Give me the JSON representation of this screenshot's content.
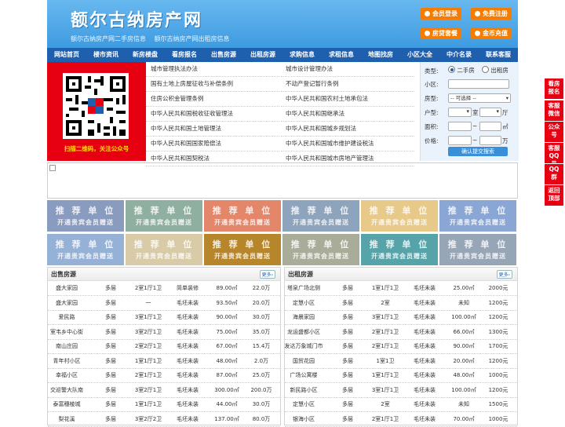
{
  "header": {
    "logo": "额尔古纳房产网",
    "sublinks": [
      "额尔古纳房产网二手房信息",
      "额尔古纳房产网出租房信息"
    ],
    "buttons": [
      "会员登录",
      "免费注册",
      "房贷套餐",
      "金币充值"
    ]
  },
  "nav": [
    "网站首页",
    "楼市资讯",
    "新房楼盘",
    "看房报名",
    "出售房源",
    "出租房源",
    "求购信息",
    "求租信息",
    "地图找房",
    "小区大全",
    "中介名录",
    "联系客服"
  ],
  "qr": {
    "caption": "扫描二维码，关注公众号"
  },
  "laws": {
    "left": [
      "城市管理执法办法",
      "国有土地上房屋征收与补偿条例",
      "住房公积金管理条例",
      "中华人民共和国税收征收管理法",
      "中华人民共和国土地管理法",
      "中华人民共和国国家赔偿法",
      "中华人民共和国契税法"
    ],
    "right": [
      "城市设计管理办法",
      "不动产登记暂行条例",
      "中华人民共和国农村土地承包法",
      "中华人民共和国继承法",
      "中华人民共和国城乡规划法",
      "中华人民共和国城市维护建设税法",
      "中华人民共和国城市房地产管理法"
    ]
  },
  "search": {
    "type_label": "类型:",
    "radio1": "二手房",
    "radio2": "出租房",
    "community_label": "小区:",
    "room_type_label": "房型:",
    "room_type_value": "-- 可选择 --",
    "layout_label": "户型:",
    "room_unit": "室",
    "hall_unit": "厅",
    "area_label": "面积:",
    "area_unit": "㎡",
    "price_label": "价格:",
    "price_unit": "万",
    "tilde": "~",
    "submit": "确认提交搜索"
  },
  "ads": {
    "line1": "推 荐 单 位",
    "line2": "开通贵宾会员赠送"
  },
  "ad_colors": [
    "#8a9bc0",
    "#8fb0a0",
    "#e4866a",
    "#8ea3bc",
    "#e7c98a",
    "#8aa6d4",
    "#96b1d6",
    "#d9cba8",
    "#b8862a",
    "#a8ac98",
    "#56a3aa",
    "#97a6b6"
  ],
  "sale": {
    "title": "出售房源",
    "more": "更多",
    "rows": [
      [
        "盛大家园",
        "多层",
        "2室1厅1卫",
        "简单装修",
        "89.00㎡",
        "22.0万"
      ],
      [
        "盛大家园",
        "多层",
        "一",
        "毛坯未装",
        "93.50㎡",
        "20.0万"
      ],
      [
        "爱民路",
        "多层",
        "3室1厅1卫",
        "毛坯未装",
        "90.00㎡",
        "30.0万"
      ],
      [
        "室韦乡中心街",
        "多层",
        "3室2厅1卫",
        "毛坯未装",
        "75.00㎡",
        "35.0万"
      ],
      [
        "南山庄园",
        "多层",
        "2室2厅1卫",
        "毛坯未装",
        "67.00㎡",
        "15.4万"
      ],
      [
        "青年村小区",
        "多层",
        "1室1厅1卫",
        "毛坯未装",
        "48.00㎡",
        "2.0万"
      ],
      [
        "幸福小区",
        "多层",
        "2室1厅1卫",
        "毛坯未装",
        "87.00㎡",
        "25.0万"
      ],
      [
        "交巡警大队南",
        "多层",
        "3室2厅1卫",
        "毛坯未装",
        "300.00㎡",
        "200.0万"
      ],
      [
        "泰富穗棱城",
        "多层",
        "1室1厅1卫",
        "毛坯未装",
        "44.00㎡",
        "30.0万"
      ],
      [
        "梨花溪",
        "多层",
        "3室2厅2卫",
        "毛坯未装",
        "137.00㎡",
        "80.0万"
      ]
    ]
  },
  "rent": {
    "title": "出租房源",
    "more": "更多",
    "rows": [
      [
        "塔泉广场北侧",
        "多层",
        "1室1厅1卫",
        "毛坯未装",
        "25.00㎡",
        "2000元"
      ],
      [
        "定慧小区",
        "多层",
        "2室",
        "毛坯未装",
        "未知",
        "1200元"
      ],
      [
        "海晨家园",
        "多层",
        "3室1厅1卫",
        "毛坯未装",
        "100.00㎡",
        "1200元"
      ],
      [
        "龙运盛都小区",
        "多层",
        "2室1厅1卫",
        "毛坯未装",
        "66.00㎡",
        "1300元"
      ],
      [
        "发达万象城门市",
        "多层",
        "2室1厅1卫",
        "毛坯未装",
        "90.00㎡",
        "1700元"
      ],
      [
        "国贸花园",
        "多层",
        "1室1卫",
        "毛坯未装",
        "20.00㎡",
        "1200元"
      ],
      [
        "广场公寓楼",
        "多层",
        "1室1厅1卫",
        "毛坯未装",
        "48.00㎡",
        "1000元"
      ],
      [
        "新民路小区",
        "多层",
        "3室1厅1卫",
        "毛坯未装",
        "100.00㎡",
        "1200元"
      ],
      [
        "定慧小区",
        "多层",
        "2室",
        "毛坯未装",
        "未知",
        "1500元"
      ],
      [
        "银海小区",
        "多层",
        "2室1厅1卫",
        "毛坯未装",
        "70.00㎡",
        "1000元"
      ]
    ]
  },
  "float": [
    "看房报名",
    "客服微信",
    "公众号",
    "客服QQ号",
    "QQ群",
    "返回顶部"
  ]
}
